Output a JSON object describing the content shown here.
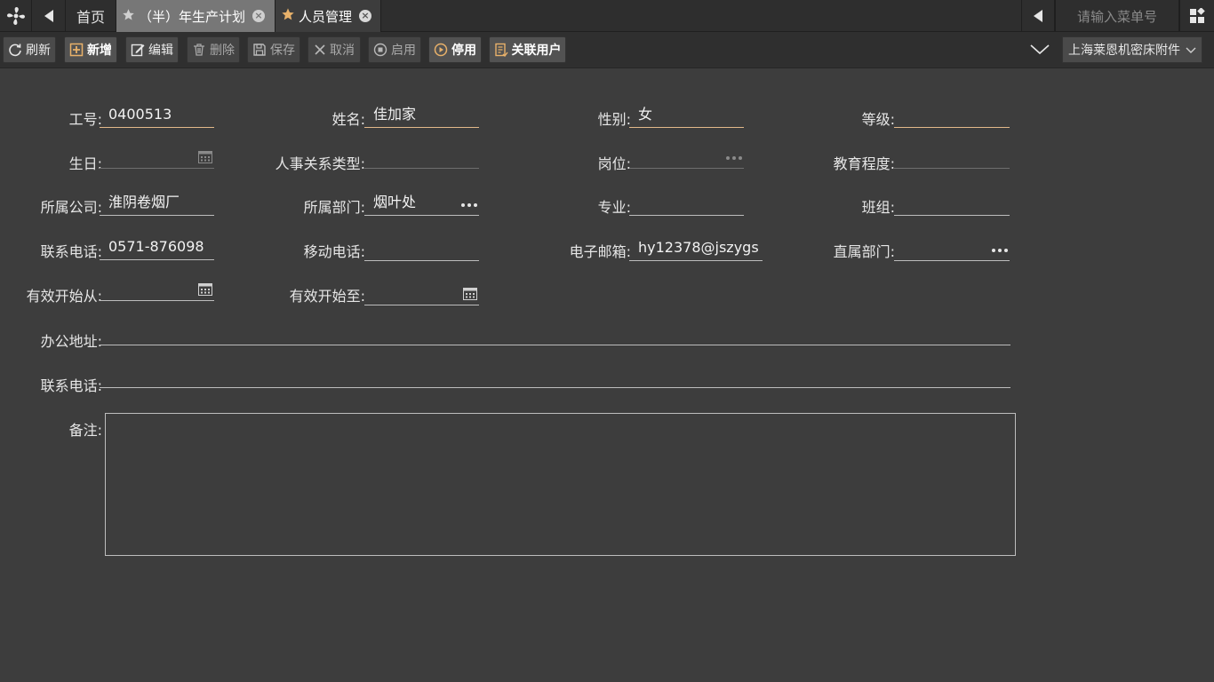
{
  "tabs": {
    "home": "首页",
    "plan": "（半）年生产计划",
    "people": "人员管理"
  },
  "search": {
    "placeholder": "请输入菜单号"
  },
  "toolbar": {
    "refresh": "刷新",
    "add": "新增",
    "edit": "编辑",
    "delete": "删除",
    "save": "保存",
    "cancel": "取消",
    "enable": "启用",
    "disable": "停用",
    "link_user": "关联用户",
    "company": "上海莱恩机密床附件"
  },
  "form": {
    "emp_no": {
      "label": "工号:",
      "value": "0400513"
    },
    "name": {
      "label": "姓名:",
      "value": "佳加家"
    },
    "gender": {
      "label": "性别:",
      "value": "女"
    },
    "grade": {
      "label": "等级:",
      "value": ""
    },
    "birthday": {
      "label": "生日:",
      "value": ""
    },
    "hr_type": {
      "label": "人事关系类型:",
      "value": ""
    },
    "post": {
      "label": "岗位:",
      "value": ""
    },
    "education": {
      "label": "教育程度:",
      "value": ""
    },
    "company": {
      "label": "所属公司:",
      "value": "淮阴卷烟厂"
    },
    "department": {
      "label": "所属部门:",
      "value": "烟叶处"
    },
    "major": {
      "label": "专业:",
      "value": ""
    },
    "team": {
      "label": "班组:",
      "value": ""
    },
    "phone": {
      "label": "联系电话:",
      "value": "0571-876098"
    },
    "mobile": {
      "label": "移动电话:",
      "value": ""
    },
    "email": {
      "label": "电子邮箱:",
      "value": "hy12378@jszygs"
    },
    "direct_dept": {
      "label": "直属部门:",
      "value": ""
    },
    "valid_from": {
      "label": "有效开始从:",
      "value": ""
    },
    "valid_to": {
      "label": "有效开始至:",
      "value": ""
    },
    "office_address": {
      "label": "办公地址:",
      "value": ""
    },
    "contact_phone": {
      "label": "联系电话:",
      "value": ""
    },
    "remark": {
      "label": "备注:",
      "value": ""
    }
  }
}
